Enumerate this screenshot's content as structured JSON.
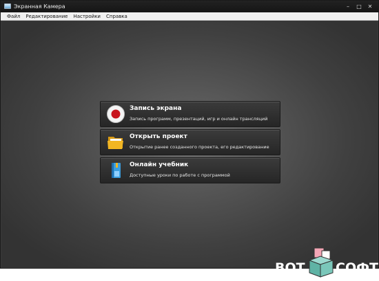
{
  "window": {
    "title": "Экранная Камера",
    "controls": [
      "–",
      "□",
      "✕"
    ]
  },
  "menu": {
    "items": [
      {
        "label": "Файл"
      },
      {
        "label": "Редактирование"
      },
      {
        "label": "Настройки"
      },
      {
        "label": "Справка"
      }
    ]
  },
  "actions": [
    {
      "title": "Запись экрана",
      "description": "Запись программ, презентаций, игр и онлайн трансляций",
      "icon": "record-icon"
    },
    {
      "title": "Открыть проект",
      "description": "Открытие ранее созданного проекта, его редактирование",
      "icon": "folder-icon"
    },
    {
      "title": "Онлайн учебник",
      "description": "Доступные уроки по работе с программой",
      "icon": "book-icon"
    }
  ],
  "watermark": {
    "left_text": "ВОТ",
    "right_text": "СОФТ"
  },
  "colors": {
    "background": "#3a3a3a",
    "record_red": "#c8141e",
    "folder_yellow": "#f2b623",
    "book_blue": "#3b9fe0"
  }
}
